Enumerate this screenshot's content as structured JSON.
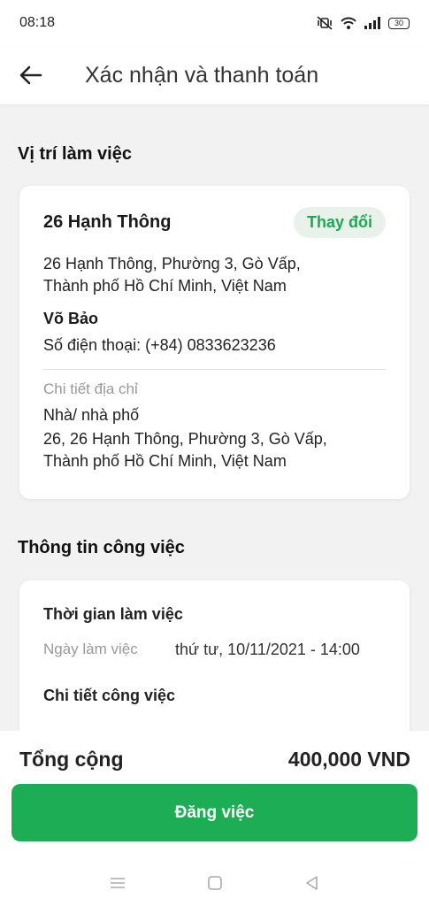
{
  "status_bar": {
    "time": "08:18",
    "battery": "30"
  },
  "header": {
    "title": "Xác nhận và thanh toán"
  },
  "location": {
    "section_title": "Vị trí làm việc",
    "name": "26 Hạnh Thông",
    "change_label": "Thay đổi",
    "address_line1": "26 Hạnh Thông, Phường 3, Gò Vấp,",
    "address_line2": "Thành phố Hồ Chí Minh, Việt Nam",
    "contact_name": "Võ Bảo",
    "phone": "Số điện thoại: (+84) 0833623236",
    "detail_label": "Chi tiết địa chỉ",
    "detail_type": "Nhà/ nhà phố",
    "detail_line1": "26, 26 Hạnh Thông, Phường 3, Gò Vấp,",
    "detail_line2": "Thành phố Hồ Chí Minh, Việt Nam"
  },
  "job": {
    "section_title": "Thông tin công việc",
    "time_title": "Thời gian làm việc",
    "date_label": "Ngày làm việc",
    "date_value": "thứ tư, 10/11/2021 - 14:00",
    "details_title": "Chi tiết công việc"
  },
  "footer": {
    "total_label": "Tổng cộng",
    "total_value": "400,000 VND",
    "post_button": "Đăng việc"
  },
  "colors": {
    "accent": "#1dae55",
    "accent_soft": "#e8f1ea"
  }
}
